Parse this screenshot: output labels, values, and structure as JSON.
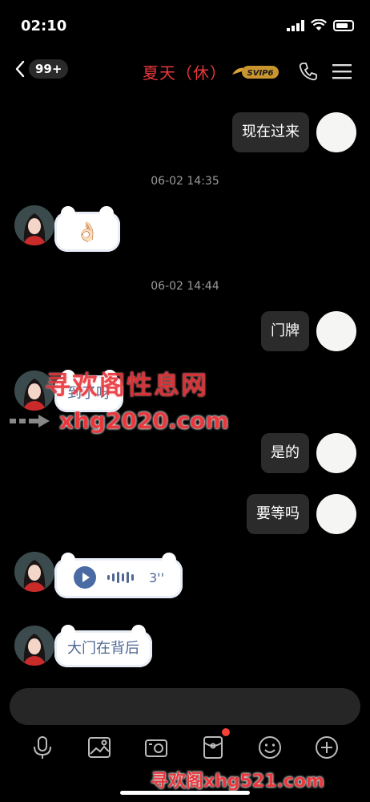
{
  "status_bar": {
    "time": "02:10"
  },
  "header": {
    "unread_count": "99+",
    "contact_name": "夏天（休）",
    "vip_label": "SVIP6"
  },
  "messages": [
    {
      "type": "text",
      "from": "self",
      "text": "现在过来"
    },
    {
      "type": "time",
      "text": "06-02 14:35"
    },
    {
      "type": "emoji",
      "from": "peer",
      "text": "👌🏻"
    },
    {
      "type": "time",
      "text": "06-02 14:44"
    },
    {
      "type": "text",
      "from": "self",
      "text": "门牌"
    },
    {
      "type": "text",
      "from": "peer",
      "text": "到了呀"
    },
    {
      "type": "text",
      "from": "self",
      "text": "是的"
    },
    {
      "type": "text",
      "from": "self",
      "text": "要等吗"
    },
    {
      "type": "voice",
      "from": "peer",
      "duration": "3''"
    },
    {
      "type": "text",
      "from": "peer",
      "text": "大门在背后"
    }
  ],
  "watermark": {
    "title": "寻欢阁性息网",
    "url": "xhg2020.com",
    "bottom": "寻欢阁xhg521.com"
  },
  "toolbar_icons": [
    "microphone-icon",
    "image-icon",
    "camera-icon",
    "red-packet-icon",
    "emoji-icon",
    "plus-icon"
  ],
  "colors": {
    "accent_red": "#e8383d",
    "bubble_out": "#2b2b2b",
    "bubble_in_text": "#4f6792",
    "background": "#000000"
  }
}
